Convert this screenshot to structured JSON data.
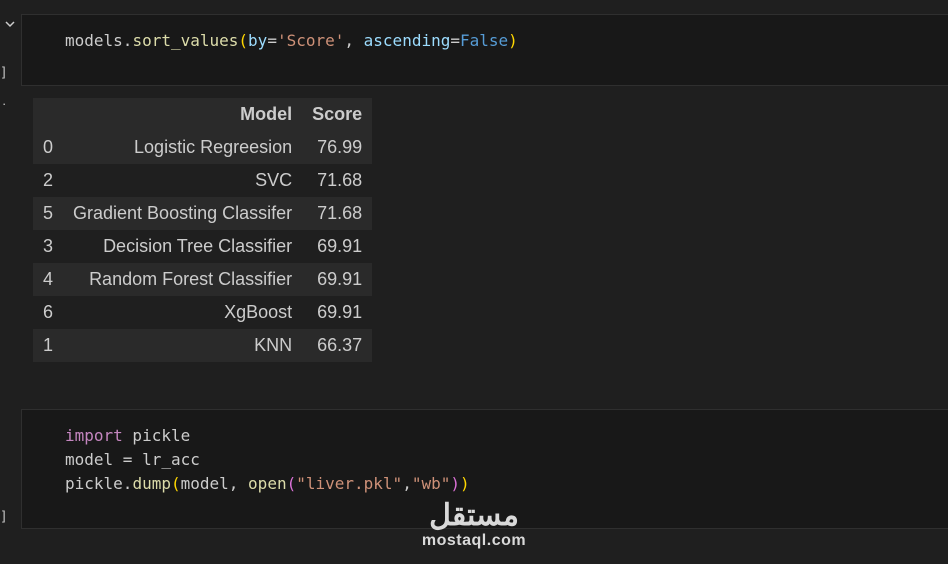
{
  "cells": [
    {
      "code_lines": [
        [
          {
            "t": "models.",
            "c": ""
          },
          {
            "t": "sort_values",
            "c": "fn"
          },
          {
            "t": "(",
            "c": "p1"
          },
          {
            "t": "by",
            "c": "param"
          },
          {
            "t": "=",
            "c": ""
          },
          {
            "t": "'Score'",
            "c": "str"
          },
          {
            "t": ", ",
            "c": ""
          },
          {
            "t": "ascending",
            "c": "param"
          },
          {
            "t": "=",
            "c": ""
          },
          {
            "t": "False",
            "c": "const"
          },
          {
            "t": ")",
            "c": "p1"
          }
        ]
      ],
      "gutter_label": "]",
      "edge_label": "P"
    },
    {
      "code_lines": [
        [
          {
            "t": "import",
            "c": "kw"
          },
          {
            "t": " pickle",
            "c": ""
          }
        ],
        [
          {
            "t": "model = lr_acc",
            "c": ""
          }
        ],
        [
          {
            "t": "pickle.",
            "c": ""
          },
          {
            "t": "dump",
            "c": "fn"
          },
          {
            "t": "(",
            "c": "p1"
          },
          {
            "t": "model, ",
            "c": ""
          },
          {
            "t": "open",
            "c": "fn"
          },
          {
            "t": "(",
            "c": "p2"
          },
          {
            "t": "\"liver.pkl\"",
            "c": "str"
          },
          {
            "t": ",",
            "c": ""
          },
          {
            "t": "\"wb\"",
            "c": "str"
          },
          {
            "t": ")",
            "c": "p2"
          },
          {
            "t": ")",
            "c": "p1"
          }
        ]
      ],
      "gutter_label": "]",
      "edge_label": "P"
    }
  ],
  "output_table": {
    "headers": [
      "",
      "Model",
      "Score"
    ],
    "rows": [
      [
        "0",
        "Logistic Regreesion",
        "76.99"
      ],
      [
        "2",
        "SVC",
        "71.68"
      ],
      [
        "5",
        "Gradient Boosting Classifer",
        "71.68"
      ],
      [
        "3",
        "Decision Tree Classifier",
        "69.91"
      ],
      [
        "4",
        "Random Forest Classifier",
        "69.91"
      ],
      [
        "6",
        "XgBoost",
        "69.91"
      ],
      [
        "1",
        "KNN",
        "66.37"
      ]
    ]
  },
  "watermark": {
    "logo": "مستقل",
    "text": "mostaql.com"
  },
  "colors": {
    "background": "#1f1f1f",
    "cell_background": "#181818",
    "row_alt": "#2a2a2a"
  },
  "icons": {
    "collapse": "chevron-down-icon"
  }
}
